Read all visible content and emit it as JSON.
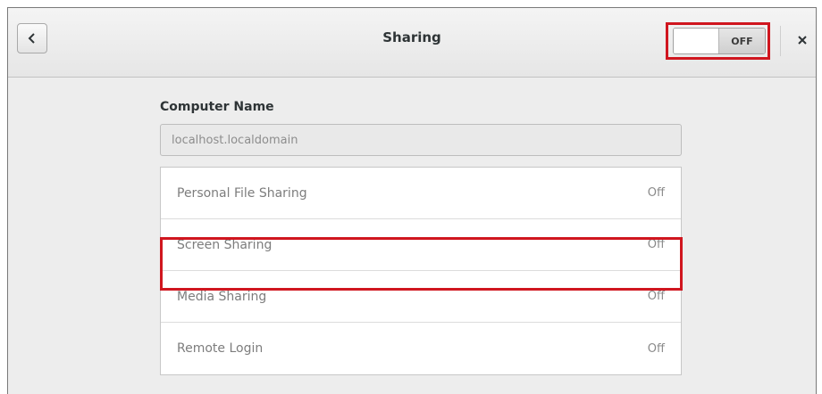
{
  "window": {
    "title": "Sharing"
  },
  "header": {
    "back_icon": "chevron-left-icon",
    "master_toggle": {
      "state_label": "OFF",
      "enabled": false
    },
    "close_icon": "close-icon",
    "highlight_color": "#d0161f"
  },
  "computer_name": {
    "label": "Computer Name",
    "value": "localhost.localdomain"
  },
  "services": [
    {
      "label": "Personal File Sharing",
      "status": "Off",
      "highlighted": true
    },
    {
      "label": "Screen Sharing",
      "status": "Off",
      "highlighted": false
    },
    {
      "label": "Media Sharing",
      "status": "Off",
      "highlighted": false
    },
    {
      "label": "Remote Login",
      "status": "Off",
      "highlighted": false
    }
  ]
}
